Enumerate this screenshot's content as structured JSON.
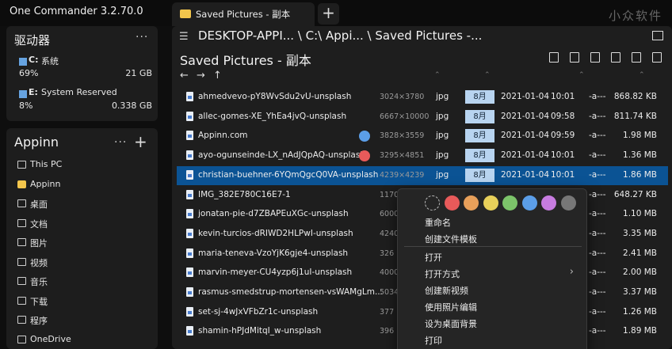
{
  "app": {
    "title": "One Commander 3.2.70.0",
    "watermark": "小众软件"
  },
  "tabs": [
    {
      "label": "Saved Pictures - 副本"
    }
  ],
  "new_tab_label": "+",
  "drives": {
    "title": "驱动器",
    "items": [
      {
        "letter": "C:",
        "name": "系统",
        "percent": "69%",
        "size": "21 GB",
        "usage_fraction": 0.69
      },
      {
        "letter": "E:",
        "name": "System Reserved",
        "percent": "8%",
        "size": "0.338 GB",
        "usage_fraction": 0.08
      }
    ]
  },
  "favorites": {
    "title": "Appinn",
    "items": [
      {
        "label": "This PC",
        "icon": "monitor-icon"
      },
      {
        "label": "Appinn",
        "icon": "folder-icon"
      },
      {
        "label": "桌面",
        "icon": "desktop-icon"
      },
      {
        "label": "文档",
        "icon": "document-icon"
      },
      {
        "label": "图片",
        "icon": "picture-icon"
      },
      {
        "label": "视频",
        "icon": "video-icon"
      },
      {
        "label": "音乐",
        "icon": "music-icon"
      },
      {
        "label": "下载",
        "icon": "download-icon"
      },
      {
        "label": "程序",
        "icon": "apps-icon"
      },
      {
        "label": "OneDrive",
        "icon": "cloud-icon"
      }
    ]
  },
  "main": {
    "path": "DESKTOP-APPI... \\ C:\\ Appi... \\ Saved Pictures -...",
    "folder_title": "Saved Pictures - 副本",
    "nav": "← → ↑"
  },
  "files": [
    {
      "name": "ahmedvevo-pY8WvSdu2vU-unsplash",
      "dim": "3024×3780",
      "ext": "jpg",
      "month": "8月",
      "date": "2021-01-04",
      "time": "10:01",
      "attr": "-a---",
      "size": "868.82 KB",
      "tag": ""
    },
    {
      "name": "allec-gomes-XE_YhEa4jvQ-unsplash",
      "dim": "6667×10000",
      "ext": "jpg",
      "month": "8月",
      "date": "2021-01-04",
      "time": "09:58",
      "attr": "-a---",
      "size": "811.74 KB",
      "tag": ""
    },
    {
      "name": "Appinn.com",
      "dim": "3828×3559",
      "ext": "jpg",
      "month": "8月",
      "date": "2021-01-04",
      "time": "09:59",
      "attr": "-a---",
      "size": "1.98 MB",
      "tag": "#5b9ee8"
    },
    {
      "name": "ayo-ogunseinde-LX_nAdJQpAQ-unsplash",
      "dim": "3295×4851",
      "ext": "jpg",
      "month": "8月",
      "date": "2021-01-04",
      "time": "10:01",
      "attr": "-a---",
      "size": "1.36 MB",
      "tag": "#e85a5a"
    },
    {
      "name": "christian-buehner-6YQmQgcQ0VA-unsplash",
      "dim": "4239×4239",
      "ext": "jpg",
      "month": "8月",
      "date": "2021-01-04",
      "time": "10:01",
      "attr": "-a---",
      "size": "1.86 MB",
      "tag": ""
    },
    {
      "name": "IMG_382E780C16E7-1",
      "dim": "1170",
      "ext": "",
      "month": "",
      "date": "",
      "time": "",
      "attr": "-a---",
      "size": "648.27 KB",
      "tag": ""
    },
    {
      "name": "jonatan-pie-d7ZBAPEuXGc-unsplash",
      "dim": "6000",
      "ext": "",
      "month": "",
      "date": "",
      "time": "",
      "attr": "-a---",
      "size": "1.10 MB",
      "tag": ""
    },
    {
      "name": "kevin-turcios-dRIWD2HLPwI-unsplash",
      "dim": "4240",
      "ext": "",
      "month": "",
      "date": "",
      "time": "",
      "attr": "-a---",
      "size": "3.35 MB",
      "tag": ""
    },
    {
      "name": "maria-teneva-VzoYjK6gje4-unsplash",
      "dim": "326",
      "ext": "",
      "month": "",
      "date": "",
      "time": "",
      "attr": "-a---",
      "size": "2.41 MB",
      "tag": ""
    },
    {
      "name": "marvin-meyer-CU4yzp6j1uI-unsplash",
      "dim": "4000",
      "ext": "",
      "month": "",
      "date": "",
      "time": "",
      "attr": "-a---",
      "size": "2.00 MB",
      "tag": ""
    },
    {
      "name": "rasmus-smedstrup-mortensen-vsWAMgLm...",
      "dim": "5034",
      "ext": "",
      "month": "",
      "date": "",
      "time": "",
      "attr": "-a---",
      "size": "3.37 MB",
      "tag": ""
    },
    {
      "name": "set-sj-4wJxVFbZr1c-unsplash",
      "dim": "377",
      "ext": "",
      "month": "",
      "date": "",
      "time": "",
      "attr": "-a---",
      "size": "1.26 MB",
      "tag": ""
    },
    {
      "name": "shamin-hPJdMitqI_w-unsplash",
      "dim": "396",
      "ext": "",
      "month": "",
      "date": "",
      "time": "",
      "attr": "-a---",
      "size": "1.89 MB",
      "tag": ""
    }
  ],
  "selected_index": 4,
  "context_menu": {
    "colors": [
      "none",
      "#e85a5a",
      "#e8a05a",
      "#e8d05a",
      "#7cc46a",
      "#5b9ee8",
      "#c77ce0",
      "#777777"
    ],
    "items": [
      {
        "label": "重命名"
      },
      {
        "label": "创建文件模板"
      },
      {
        "label": "打开"
      },
      {
        "label": "打开方式",
        "submenu": true
      },
      {
        "label": "创建新视频"
      },
      {
        "label": "使用照片编辑"
      },
      {
        "label": "设为桌面背景"
      },
      {
        "label": "打印"
      }
    ]
  }
}
